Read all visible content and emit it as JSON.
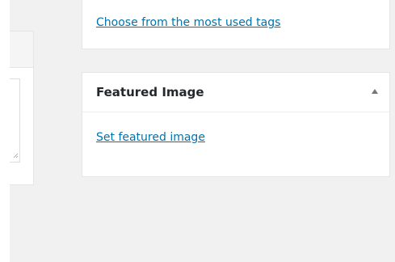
{
  "tags_box": {
    "link_label": "Choose from the most used tags"
  },
  "featured_image_box": {
    "title": "Featured Image",
    "toggle_icon": "triangle-up-icon",
    "set_link_label": "Set featured image"
  },
  "colors": {
    "link": "#0073aa",
    "background": "#f1f1f1",
    "panel": "#ffffff",
    "title": "#23282d"
  }
}
